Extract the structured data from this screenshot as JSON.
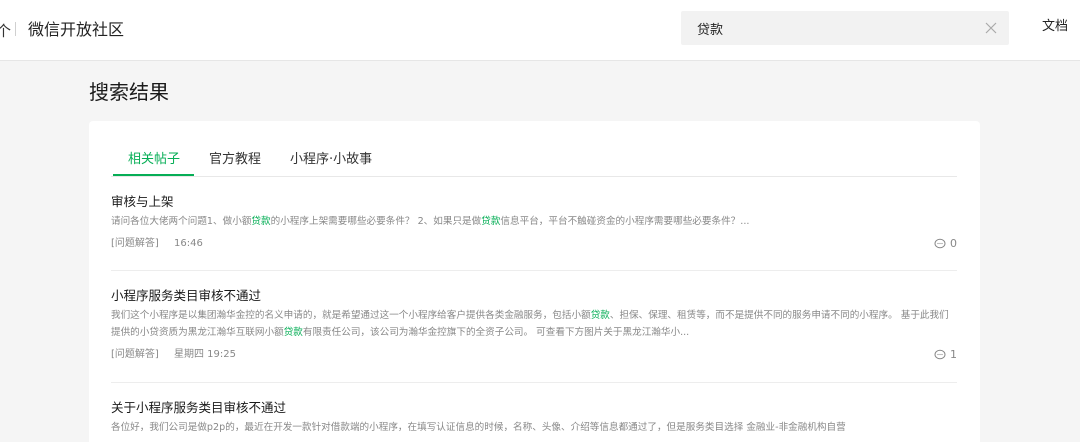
{
  "header": {
    "logo_fragment": "个",
    "site_title": "微信开放社区",
    "search_value": "贷款",
    "docs_label": "文档"
  },
  "page": {
    "title": "搜索结果"
  },
  "tabs": [
    {
      "label": "相关帖子",
      "active": true
    },
    {
      "label": "官方教程",
      "active": false
    },
    {
      "label": "小程序·小故事",
      "active": false
    }
  ],
  "posts": [
    {
      "title": "审核与上架",
      "excerpt_parts": [
        {
          "t": "请问各位大佬两个问题1、做小额"
        },
        {
          "t": "贷款",
          "hl": true
        },
        {
          "t": "的小程序上架需要哪些必要条件？ 2、如果只是做"
        },
        {
          "t": "贷款",
          "hl": true
        },
        {
          "t": "信息平台，平台不触碰资金的小程序需要哪些必要条件？..."
        }
      ],
      "tag": "[问题解答]",
      "time": "16:46",
      "comments": "0"
    },
    {
      "title": "小程序服务类目审核不通过",
      "excerpt_parts": [
        {
          "t": "我们这个小程序是以集团瀚华金控的名义申请的，就是希望通过这一个小程序给客户提供各类金融服务，包括小额"
        },
        {
          "t": "贷款",
          "hl": true
        },
        {
          "t": "、担保、保理、租赁等，而不是提供不同的服务申请不同的小程序。 基于此我们提供的小贷资质为黑龙江瀚华互联网小额"
        },
        {
          "t": "贷款",
          "hl": true
        },
        {
          "t": "有限责任公司，该公司为瀚华金控旗下的全资子公司。 可查看下方图片关于黑龙江瀚华小..."
        }
      ],
      "tag": "[问题解答]",
      "time": "星期四 19:25",
      "comments": "1"
    },
    {
      "title": "关于小程序服务类目审核不通过",
      "excerpt_parts": [
        {
          "t": "各位好，我们公司是做p2p的，最近在开发一款针对借款端的小程序，在填写认证信息的时候，名称、头像、介绍等信息都通过了，但是服务类目选择 金融业-非金融机构自营"
        }
      ],
      "tag": "",
      "time": "",
      "comments": ""
    }
  ],
  "colors": {
    "accent": "#06ae56",
    "muted": "#888888"
  }
}
